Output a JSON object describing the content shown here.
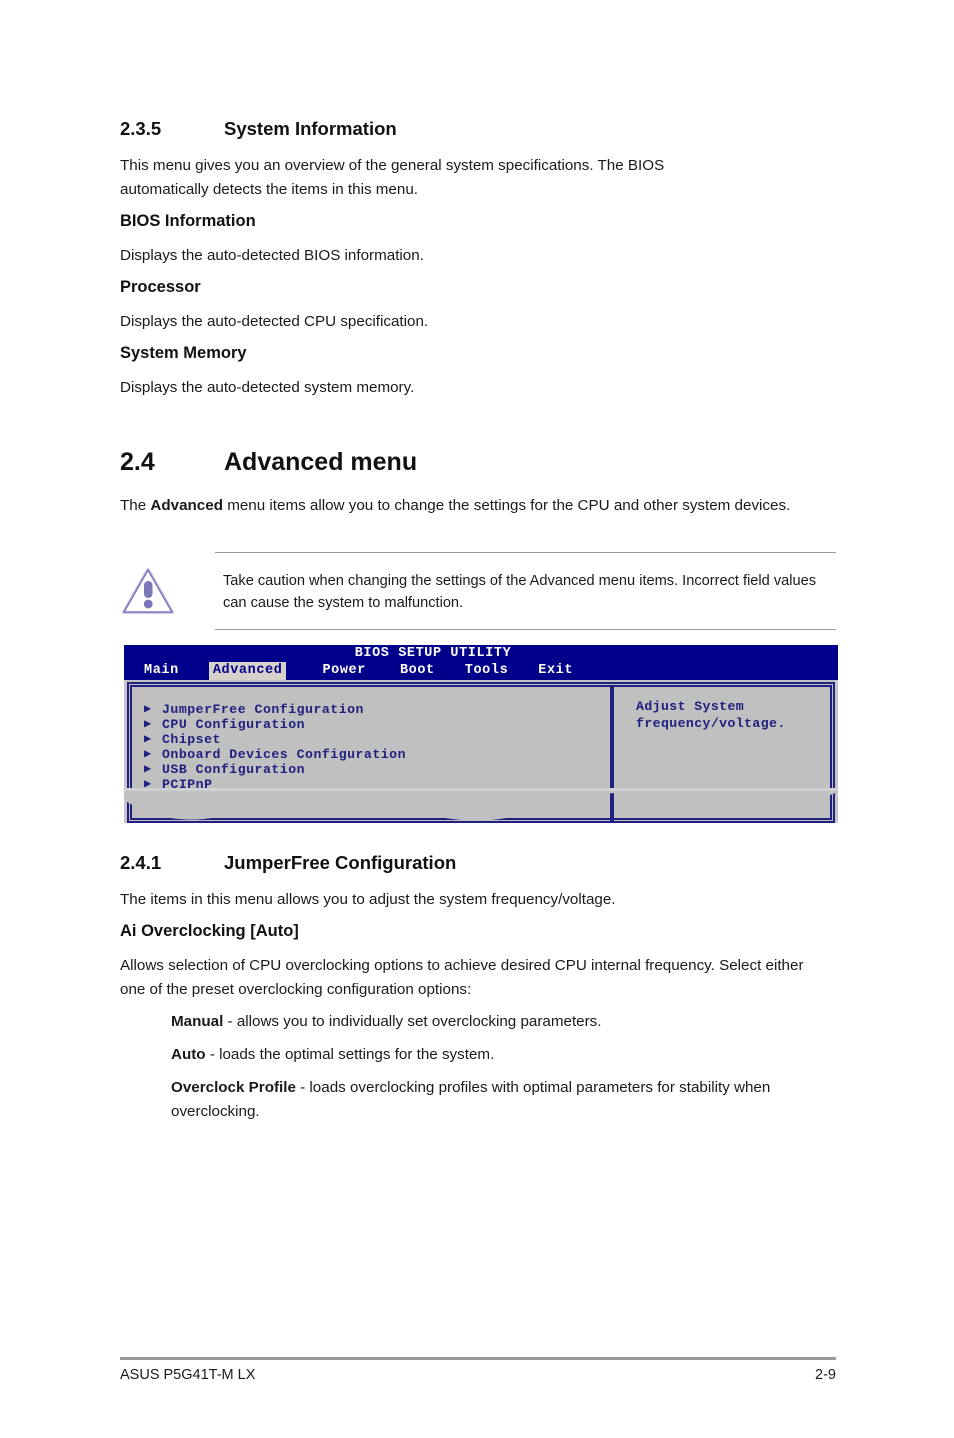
{
  "sections": {
    "sys_info": {
      "number": "2.3.5",
      "title": "System Information",
      "intro": "This menu gives you an overview of the general system specifications. The BIOS automatically detects the items in this menu.",
      "sub1_title": "BIOS Information",
      "sub1_text": "Displays the auto-detected BIOS information.",
      "sub2_title": "Processor",
      "sub2_text": "Displays the auto-detected CPU specification.",
      "sub3_title": "System Memory",
      "sub3_text": "Displays the auto-detected system memory."
    },
    "advanced": {
      "number": "2.4",
      "title": "Advanced menu",
      "intro_pre": "The ",
      "intro_bold": "Advanced",
      "intro_post": " menu items allow you to change the settings for the CPU and other system devices.",
      "note_icon": "warning-triangle-icon",
      "note_text": "Take caution when changing the settings of the Advanced menu items. Incorrect field values can cause the system to malfunction."
    },
    "jumperfree": {
      "number": "2.4.1",
      "title": "JumperFree Configuration",
      "intro": "The items in this menu allows you to adjust the system frequency/voltage.",
      "sub_title": "Ai Overclocking [Auto]",
      "sub_text": "Allows selection of CPU overclocking options to achieve desired CPU internal frequency. Select either one of the preset overclocking configuration options:",
      "options": [
        {
          "name": "Manual",
          "desc": " - allows you to individually set overclocking parameters."
        },
        {
          "name": "Auto",
          "desc": " - loads the optimal settings for the system."
        },
        {
          "name": "Overclock Profile",
          "desc": " - loads overclocking profiles with optimal parameters for stability when overclocking."
        }
      ]
    }
  },
  "bios_screenshot": {
    "title": "BIOS SETUP UTILITY",
    "tabs": [
      {
        "label": "Main",
        "selected": false
      },
      {
        "label": "Advanced",
        "selected": true
      },
      {
        "label": "Power",
        "selected": false
      },
      {
        "label": "Boot",
        "selected": false
      },
      {
        "label": "Tools",
        "selected": false
      },
      {
        "label": "Exit",
        "selected": false
      }
    ],
    "menu_items": [
      "JumperFree Configuration",
      "CPU Configuration",
      "Chipset",
      "Onboard Devices Configuration",
      "USB Configuration",
      "PCIPnP"
    ],
    "arrow_glyph": "▶",
    "help_text": "Adjust System frequency/voltage.",
    "colors": {
      "titlebar_bg": "#00008b",
      "panel_bg": "#c0c0c0",
      "text_blue": "#202080",
      "tab_selected_bg": "#d6d2cb"
    }
  },
  "footer": {
    "left": "ASUS P5G41T-M LX",
    "right": "2-9"
  }
}
